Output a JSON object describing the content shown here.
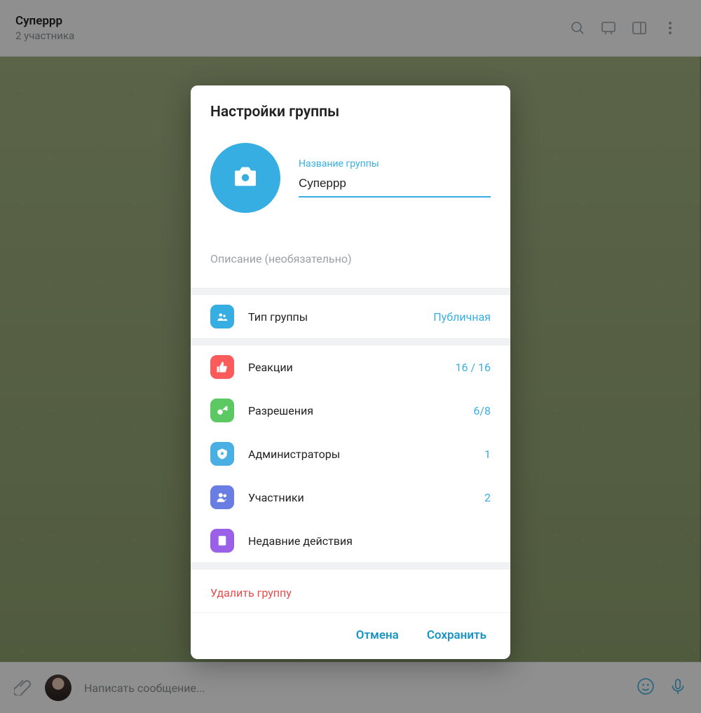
{
  "header": {
    "chat_title": "Суперрр",
    "chat_subtitle": "2 участника"
  },
  "compose": {
    "placeholder": "Написать сообщение..."
  },
  "modal": {
    "title": "Настройки группы",
    "name_field_label": "Название группы",
    "name_value": "Суперрр",
    "description_placeholder": "Описание (необязательно)",
    "type_item": {
      "label": "Тип группы",
      "value": "Публичная"
    },
    "reactions_item": {
      "label": "Реакции",
      "value": "16 / 16"
    },
    "permissions_item": {
      "label": "Разрешения",
      "value": "6/8"
    },
    "admins_item": {
      "label": "Администраторы",
      "value": "1"
    },
    "members_item": {
      "label": "Участники",
      "value": "2"
    },
    "recent_actions_item": {
      "label": "Недавние действия",
      "value": ""
    },
    "delete_label": "Удалить группу",
    "cancel_label": "Отмена",
    "save_label": "Сохранить"
  }
}
